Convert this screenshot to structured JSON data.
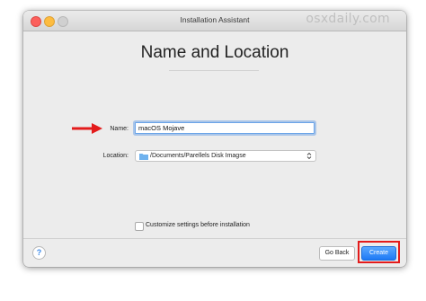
{
  "window": {
    "title": "Installation Assistant",
    "watermark": "osxdaily.com"
  },
  "page": {
    "heading": "Name and Location"
  },
  "form": {
    "name_label": "Name:",
    "name_value": "macOS Mojave",
    "location_label": "Location:",
    "location_value": "/Documents/Parellels Disk Imagse",
    "customize_label": "Customize settings before installation",
    "customize_checked": false
  },
  "footer": {
    "help": "?",
    "back_label": "Go Back",
    "create_label": "Create"
  },
  "colors": {
    "arrow": "#e31b1b",
    "highlight": "#e31b1b",
    "primary_button": "#1e79f5"
  },
  "icons": {
    "help": "question-icon",
    "location": "folder-icon",
    "select": "updown-chevron-icon"
  }
}
